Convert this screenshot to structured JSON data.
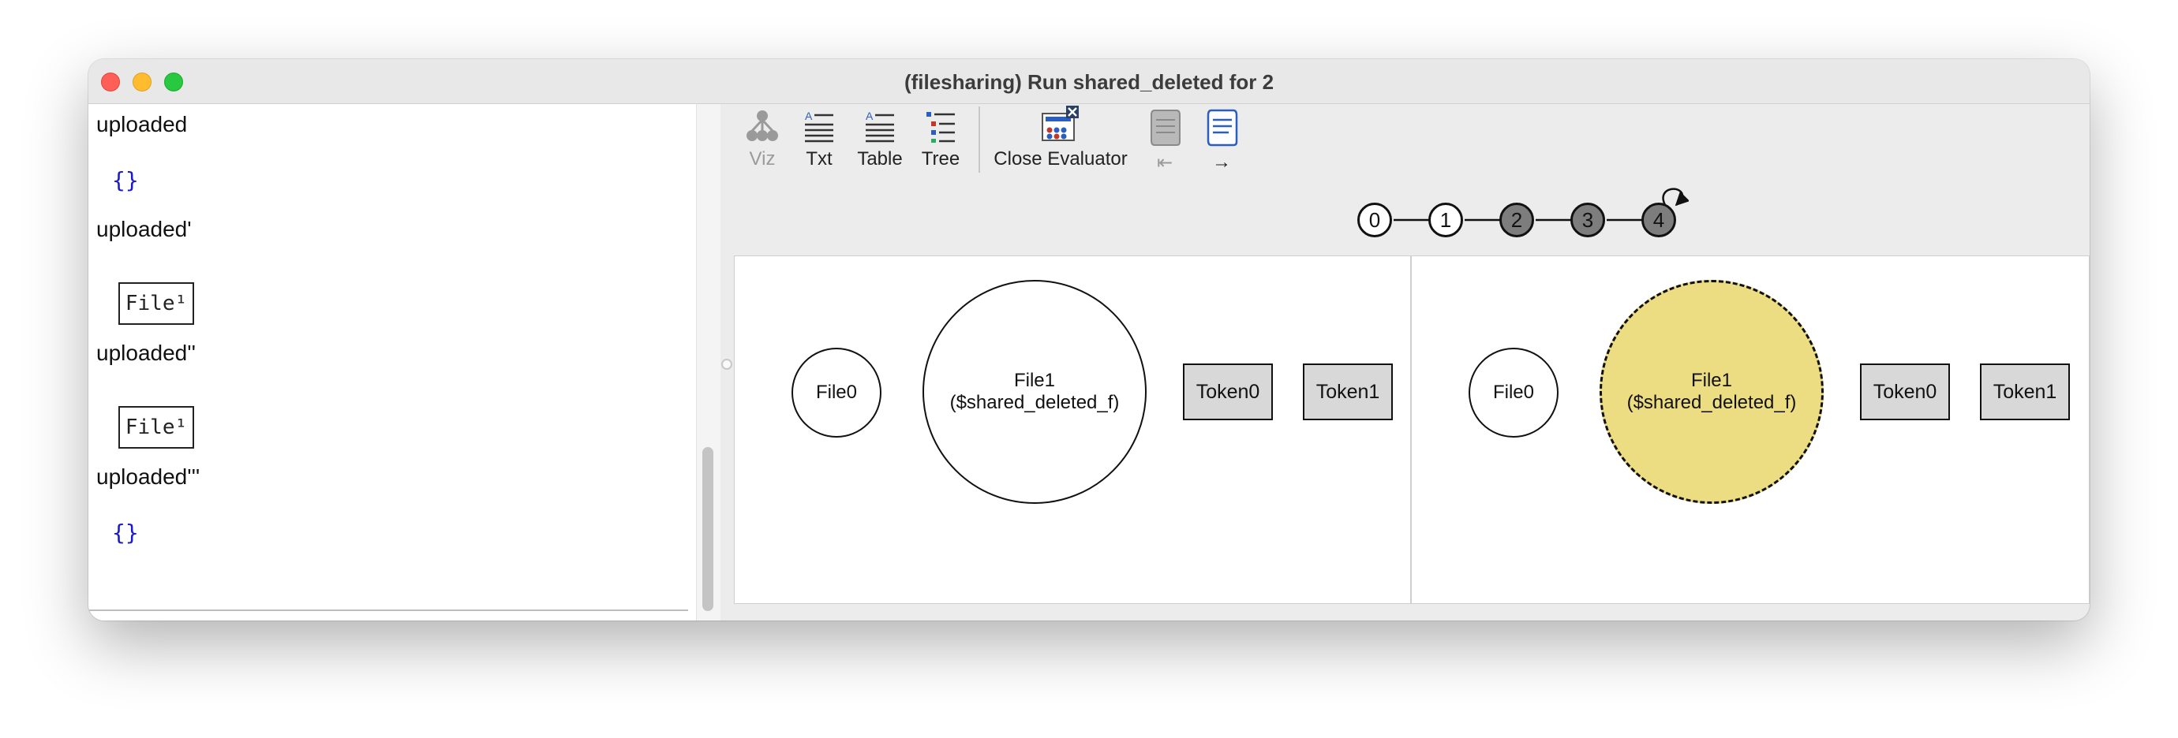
{
  "window": {
    "title": "(filesharing) Run shared_deleted for 2"
  },
  "evaluator": {
    "entries": [
      {
        "name": "uploaded",
        "value": "{}",
        "kind": "empty"
      },
      {
        "name": "uploaded'",
        "value": "File¹",
        "kind": "atom"
      },
      {
        "name": "uploaded''",
        "value": "File¹",
        "kind": "atom"
      },
      {
        "name": "uploaded'''",
        "value": "{}",
        "kind": "empty"
      }
    ],
    "input_value": ""
  },
  "toolbar": {
    "viz": "Viz",
    "txt": "Txt",
    "table": "Table",
    "tree": "Tree",
    "close_evaluator": "Close Evaluator",
    "prev": "⇤",
    "next": "→",
    "viz_enabled": false,
    "prev_enabled": false
  },
  "trace": {
    "states": [
      "0",
      "1",
      "2",
      "3",
      "4"
    ],
    "current_state": "4",
    "loop_back_state": "4",
    "colors": {
      "visited": "#7d7d7d",
      "unvisited": "#ffffff"
    }
  },
  "graphs": {
    "left": {
      "file0": "File0",
      "file1": "File1",
      "file1_skolem": "($shared_deleted_f)",
      "token0": "Token0",
      "token1": "Token1"
    },
    "right": {
      "file0": "File0",
      "file1": "File1",
      "file1_skolem": "($shared_deleted_f)",
      "token0": "Token0",
      "token1": "Token1",
      "highlight_color": "#ecdc82"
    }
  }
}
